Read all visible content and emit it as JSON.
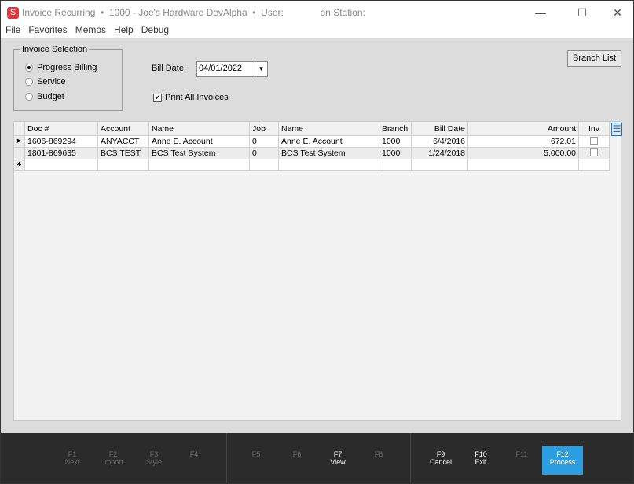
{
  "title": {
    "app": "Invoice Recurring  •  1000 - Joe's Hardware DevAlpha  •  User:              on Station:",
    "logo": "S"
  },
  "menu": [
    "File",
    "Favorites",
    "Memos",
    "Help",
    "Debug"
  ],
  "selection": {
    "title": "Invoice Selection",
    "options": [
      "Progress Billing",
      "Service",
      "Budget"
    ],
    "selected": 0
  },
  "bill_date": {
    "label": "Bill Date:",
    "value": "04/01/2022"
  },
  "print_all": {
    "label": "Print All Invoices",
    "checked": true
  },
  "branch_list": "Branch List",
  "grid": {
    "columns": [
      "Doc #",
      "Account",
      "Name",
      "Job",
      "Name",
      "Branch",
      "Bill Date",
      "Amount",
      "Inv"
    ],
    "rows": [
      [
        "1606-869294",
        "ANYACCT",
        "Anne E. Account",
        "0",
        "Anne E. Account",
        "1000",
        "6/4/2016",
        "672.01",
        ""
      ],
      [
        "1801-869635",
        "BCS TEST",
        "BCS Test System",
        "0",
        "BCS Test System",
        "1000",
        "1/24/2018",
        "5,000.00",
        ""
      ]
    ]
  },
  "fkeys": [
    {
      "key": "F1",
      "label": "Next"
    },
    {
      "key": "F2",
      "label": "Import"
    },
    {
      "key": "F3",
      "label": "Style"
    },
    {
      "key": "F4",
      "label": ""
    },
    {
      "key": "F5",
      "label": ""
    },
    {
      "key": "F6",
      "label": ""
    },
    {
      "key": "F7",
      "label": "View"
    },
    {
      "key": "F8",
      "label": ""
    },
    {
      "key": "F9",
      "label": "Cancel"
    },
    {
      "key": "F10",
      "label": "Exit"
    },
    {
      "key": "F11",
      "label": ""
    },
    {
      "key": "F12",
      "label": "Process"
    }
  ]
}
